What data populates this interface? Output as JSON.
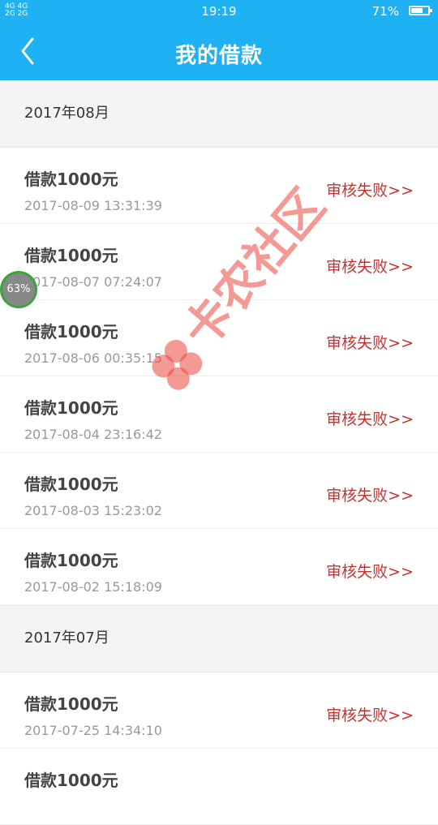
{
  "status_bar": {
    "signal": "4G 4G\n2G 2G",
    "time": "19:19",
    "battery_pct": "71%",
    "battery_level": 0.71
  },
  "navbar": {
    "title": "我的借款",
    "back_icon": "chevron-left-icon"
  },
  "sections": [
    {
      "header": "2017年08月",
      "rows": [
        {
          "title": "借款1000元",
          "time": "2017-08-09 13:31:39",
          "status": "审核失败>>"
        },
        {
          "title": "借款1000元",
          "time": "2017-08-07 07:24:07",
          "status": "审核失败>>"
        },
        {
          "title": "借款1000元",
          "time": "2017-08-06 00:35:15",
          "status": "审核失败>>"
        },
        {
          "title": "借款1000元",
          "time": "2017-08-04 23:16:42",
          "status": "审核失败>>"
        },
        {
          "title": "借款1000元",
          "time": "2017-08-03 15:23:02",
          "status": "审核失败>>"
        },
        {
          "title": "借款1000元",
          "time": "2017-08-02 15:18:09",
          "status": "审核失败>>"
        }
      ]
    },
    {
      "header": "2017年07月",
      "rows": [
        {
          "title": "借款1000元",
          "time": "2017-07-25 14:34:10",
          "status": "审核失败>>"
        },
        {
          "title": "借款1000元",
          "time": "",
          "status": ""
        }
      ]
    }
  ],
  "float_badge": {
    "label": "63%"
  },
  "watermark": {
    "text": "卡农社区"
  },
  "colors": {
    "accent": "#1eb1f3",
    "status_fail": "#c9302c"
  }
}
